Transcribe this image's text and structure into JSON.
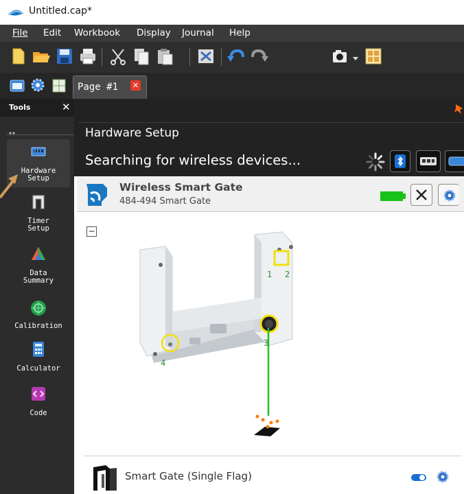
{
  "window": {
    "title": "Untitled.cap*"
  },
  "menu": {
    "items": [
      "File",
      "Edit",
      "Workbook",
      "Display",
      "Journal",
      "Help"
    ]
  },
  "tabs": {
    "page_label": "Page #1",
    "close_glyph": "✕"
  },
  "tools": {
    "title": "Tools",
    "close_glyph": "✕",
    "items": [
      {
        "line1": "Hardware",
        "line2": "Setup"
      },
      {
        "line1": "Timer",
        "line2": "Setup"
      },
      {
        "line1": "Data",
        "line2": "Summary"
      },
      {
        "line1": "Calibration",
        "line2": ""
      },
      {
        "line1": "Calculator",
        "line2": ""
      },
      {
        "line1": "Code",
        "line2": ""
      }
    ]
  },
  "hardware": {
    "title": "Hardware Setup",
    "status": "Searching for wireless devices..."
  },
  "device": {
    "name": "Wireless Smart Gate",
    "subtitle": "484-494 Smart Gate",
    "battery_color": "#19c219",
    "close_glyph": "✕",
    "collapse_glyph": "−",
    "ports": [
      "1",
      "2",
      "3",
      "4"
    ]
  },
  "sensor": {
    "name": "Smart Gate (Single Flag)"
  },
  "colors": {
    "accent_blue": "#1a78c2",
    "port_yellow": "#f2e10d",
    "wire_green": "#22c222"
  }
}
